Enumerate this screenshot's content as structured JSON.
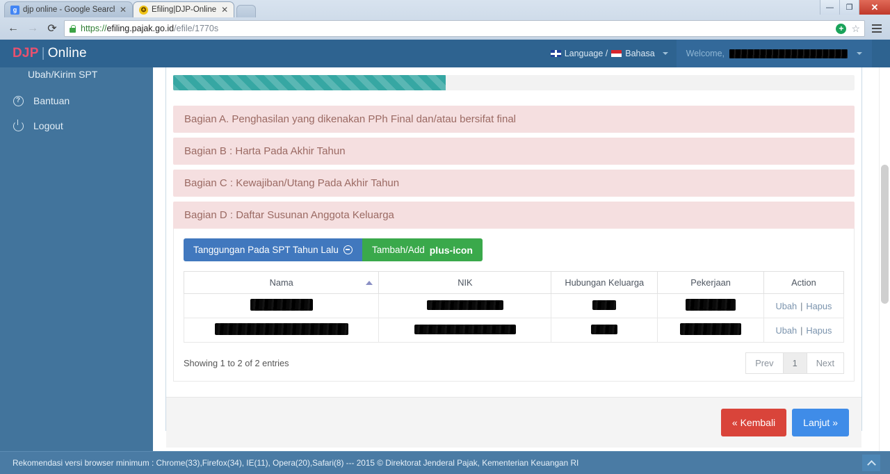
{
  "browser": {
    "tabs": [
      {
        "title": "djp online - Google Search",
        "favicon": "google-icon",
        "favicon_letter": "g",
        "active": false
      },
      {
        "title": "Efiling|DJP-Online",
        "favicon": "djp-icon",
        "favicon_letter": "✪",
        "active": true
      }
    ],
    "close_glyph": "✕",
    "nav": {
      "back": "←",
      "forward": "→",
      "reload": "⟳"
    },
    "url": {
      "scheme": "https://",
      "host": "efiling.pajak.go.id",
      "path": "/efile/1770s"
    },
    "url_icons": {
      "add": "+",
      "bookmark": "☆"
    },
    "window_controls": {
      "minimize": "—",
      "maximize": "❐",
      "close": "✕"
    }
  },
  "header": {
    "brand_djp": "DJP",
    "brand_separator": "|",
    "brand_online": "Online",
    "language_label": "Language / ",
    "bahasa_label": "Bahasa",
    "welcome_label": "Welcome,",
    "welcome_user_redacted": true
  },
  "sidebar": {
    "items": [
      {
        "label": "Ubah/Kirim SPT",
        "icon": "none",
        "partial": true
      },
      {
        "label": "Bantuan",
        "icon": "question-circle-icon",
        "icon_glyph": "?"
      },
      {
        "label": "Logout",
        "icon": "power-icon"
      }
    ]
  },
  "main": {
    "progress_percent": 40,
    "sections": [
      {
        "id": "A",
        "label": "Bagian A. Penghasilan yang dikenakan PPh Final dan/atau bersifat final",
        "open": false
      },
      {
        "id": "B",
        "label": "Bagian B : Harta Pada Akhir Tahun",
        "open": false
      },
      {
        "id": "C",
        "label": "Bagian C : Kewajiban/Utang Pada Akhir Tahun",
        "open": false
      },
      {
        "id": "D",
        "label": "Bagian D : Daftar Susunan Anggota Keluarga",
        "open": true
      }
    ],
    "toolbar": {
      "prev_year_label": "Tanggungan Pada SPT Tahun Lalu",
      "prev_year_icon": "minus-circle-icon",
      "add_label": "Tambah/Add",
      "add_icon": "plus-icon"
    },
    "table": {
      "columns": [
        {
          "key": "nama",
          "label": "Nama",
          "sorted": "asc"
        },
        {
          "key": "nik",
          "label": "NIK",
          "sorted": "none"
        },
        {
          "key": "hubungan",
          "label": "Hubungan Keluarga",
          "sorted": "none"
        },
        {
          "key": "pekerjaan",
          "label": "Pekerjaan",
          "sorted": "none"
        },
        {
          "key": "action",
          "label": "Action",
          "sorted": "none"
        }
      ],
      "rows": [
        {
          "nama": {
            "redacted": true,
            "width": 90
          },
          "nik": {
            "redacted": true,
            "width": 110
          },
          "hubungan": {
            "redacted": true,
            "width": 34
          },
          "pekerjaan": {
            "redacted": true,
            "width": 72
          },
          "edit_label": "Ubah",
          "separator": "|",
          "delete_label": "Hapus"
        },
        {
          "nama": {
            "redacted": true,
            "width": 192
          },
          "nik": {
            "redacted": true,
            "width": 146
          },
          "hubungan": {
            "redacted": true,
            "width": 38
          },
          "pekerjaan": {
            "redacted": true,
            "width": 88
          },
          "edit_label": "Ubah",
          "separator": "|",
          "delete_label": "Hapus"
        }
      ],
      "info": "Showing 1 to 2 of 2 entries",
      "pagination": {
        "prev_label": "Prev",
        "pages": [
          "1"
        ],
        "next_label": "Next",
        "current": "1"
      }
    },
    "actions": {
      "back_label": "« Kembali",
      "next_label": "Lanjut »"
    }
  },
  "footer": {
    "text": "Rekomendasi versi browser minimum : Chrome(33),Firefox(34), IE(11), Opera(20),Safari(8) --- 2015 © Direktorat Jenderal Pajak, Kementerian Keuangan RI",
    "scroll_top_icon": "chevron-up-icon"
  },
  "colors": {
    "brand_pink": "#e8516f",
    "topbar_blue": "#2e6390",
    "sidebar_blue": "#42749c",
    "section_pink": "#f5dfe0",
    "progress_teal": "#36a7a3",
    "btn_blue": "#4178be",
    "btn_green": "#3aa94b",
    "btn_red": "#d9443a",
    "btn_next_blue": "#3f8ce8"
  }
}
